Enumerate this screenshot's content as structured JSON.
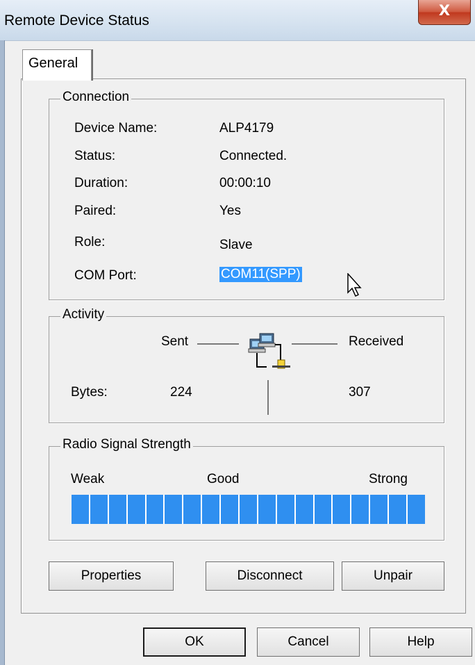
{
  "window": {
    "title": "Remote Device Status",
    "close_glyph": "X"
  },
  "tabs": [
    {
      "label": "General",
      "active": true
    }
  ],
  "connection": {
    "title": "Connection",
    "rows": [
      {
        "label": "Device Name:",
        "value": "ALP4179"
      },
      {
        "label": "Status:",
        "value": "Connected."
      },
      {
        "label": "Duration:",
        "value": "00:00:10"
      },
      {
        "label": "Paired:",
        "value": "Yes"
      },
      {
        "label": "Role:",
        "value": "Slave"
      },
      {
        "label": "COM Port:",
        "value": "COM11(SPP)"
      }
    ]
  },
  "activity": {
    "title": "Activity",
    "sent_label": "Sent",
    "received_label": "Received",
    "bytes_label": "Bytes:",
    "bytes_sent": "224",
    "bytes_received": "307",
    "icon": "network-computers-icon"
  },
  "signal": {
    "title": "Radio Signal Strength",
    "weak_label": "Weak",
    "good_label": "Good",
    "strong_label": "Strong",
    "segments_total": 19,
    "segments_filled": 19,
    "bar_color": "#2f8ff0"
  },
  "buttons": {
    "properties": "Properties",
    "disconnect": "Disconnect",
    "unpair": "Unpair",
    "ok": "OK",
    "cancel": "Cancel",
    "help": "Help"
  },
  "colors": {
    "selection": "#3399ff",
    "close_button": "#c0391f"
  }
}
